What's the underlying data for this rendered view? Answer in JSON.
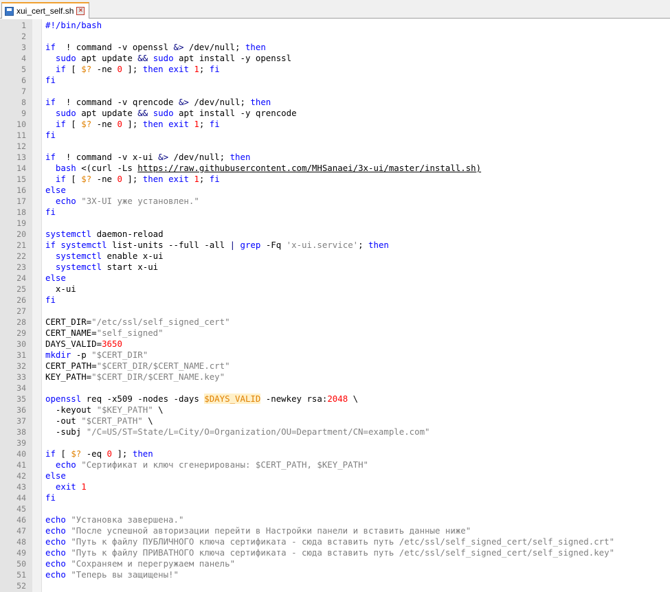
{
  "tab": {
    "filename": "xui_cert_self.sh"
  },
  "colors": {
    "keyword": "#0000ff",
    "number": "#ff0000",
    "string": "#808080",
    "variable": "#e08000",
    "tab_accent": "#f0a030",
    "gutter_bg": "#e4e4e4"
  },
  "icons": {
    "tab_file": "save-icon",
    "tab_close": "close-icon"
  },
  "lines": [
    [
      [
        "kw",
        "#!/bin/bash"
      ]
    ],
    [],
    [
      [
        "kw",
        "if"
      ],
      [
        "",
        "  "
      ],
      [
        "",
        "! command -v openssl "
      ],
      [
        "op",
        "&>"
      ],
      [
        "",
        " /dev/null; "
      ],
      [
        "kw",
        "then"
      ]
    ],
    [
      [
        "",
        "  "
      ],
      [
        "kw",
        "sudo"
      ],
      [
        "",
        " apt update "
      ],
      [
        "op",
        "&&"
      ],
      [
        "",
        " "
      ],
      [
        "kw",
        "sudo"
      ],
      [
        "",
        " apt install -y openssl"
      ]
    ],
    [
      [
        "",
        "  "
      ],
      [
        "kw",
        "if"
      ],
      [
        "",
        " [ "
      ],
      [
        "var",
        "$?"
      ],
      [
        "",
        " -ne "
      ],
      [
        "num",
        "0"
      ],
      [
        "",
        " ]; "
      ],
      [
        "kw",
        "then"
      ],
      [
        "",
        " "
      ],
      [
        "kw",
        "exit"
      ],
      [
        "",
        " "
      ],
      [
        "num",
        "1"
      ],
      [
        "",
        "; "
      ],
      [
        "kw",
        "fi"
      ]
    ],
    [
      [
        "kw",
        "fi"
      ]
    ],
    [],
    [
      [
        "kw",
        "if"
      ],
      [
        "",
        "  "
      ],
      [
        "",
        "! command -v qrencode "
      ],
      [
        "op",
        "&>"
      ],
      [
        "",
        " /dev/null; "
      ],
      [
        "kw",
        "then"
      ]
    ],
    [
      [
        "",
        "  "
      ],
      [
        "kw",
        "sudo"
      ],
      [
        "",
        " apt update "
      ],
      [
        "op",
        "&&"
      ],
      [
        "",
        " "
      ],
      [
        "kw",
        "sudo"
      ],
      [
        "",
        " apt install -y qrencode"
      ]
    ],
    [
      [
        "",
        "  "
      ],
      [
        "kw",
        "if"
      ],
      [
        "",
        " [ "
      ],
      [
        "var",
        "$?"
      ],
      [
        "",
        " -ne "
      ],
      [
        "num",
        "0"
      ],
      [
        "",
        " ]; "
      ],
      [
        "kw",
        "then"
      ],
      [
        "",
        " "
      ],
      [
        "kw",
        "exit"
      ],
      [
        "",
        " "
      ],
      [
        "num",
        "1"
      ],
      [
        "",
        "; "
      ],
      [
        "kw",
        "fi"
      ]
    ],
    [
      [
        "kw",
        "fi"
      ]
    ],
    [],
    [
      [
        "kw",
        "if"
      ],
      [
        "",
        "  "
      ],
      [
        "",
        "! command -v x-ui "
      ],
      [
        "op",
        "&>"
      ],
      [
        "",
        " /dev/null; "
      ],
      [
        "kw",
        "then"
      ]
    ],
    [
      [
        "",
        "  "
      ],
      [
        "kw",
        "bash"
      ],
      [
        "",
        " <(curl -Ls "
      ],
      [
        "url",
        "https://raw.githubusercontent.com/MHSanaei/3x-ui/master/install.sh)"
      ]
    ],
    [
      [
        "",
        "  "
      ],
      [
        "kw",
        "if"
      ],
      [
        "",
        " [ "
      ],
      [
        "var",
        "$?"
      ],
      [
        "",
        " -ne "
      ],
      [
        "num",
        "0"
      ],
      [
        "",
        " ]; "
      ],
      [
        "kw",
        "then"
      ],
      [
        "",
        " "
      ],
      [
        "kw",
        "exit"
      ],
      [
        "",
        " "
      ],
      [
        "num",
        "1"
      ],
      [
        "",
        "; "
      ],
      [
        "kw",
        "fi"
      ]
    ],
    [
      [
        "kw",
        "else"
      ]
    ],
    [
      [
        "",
        "  "
      ],
      [
        "kw",
        "echo"
      ],
      [
        "",
        " "
      ],
      [
        "str",
        "\"3X-UI уже установлен.\""
      ]
    ],
    [
      [
        "kw",
        "fi"
      ]
    ],
    [],
    [
      [
        "kw",
        "systemctl"
      ],
      [
        "",
        " daemon-reload"
      ]
    ],
    [
      [
        "kw",
        "if"
      ],
      [
        "",
        " "
      ],
      [
        "kw",
        "systemctl"
      ],
      [
        "",
        " list-units --full -all "
      ],
      [
        "op",
        "|"
      ],
      [
        "",
        " "
      ],
      [
        "kw",
        "grep"
      ],
      [
        "",
        " -Fq "
      ],
      [
        "str",
        "'x-ui.service'"
      ],
      [
        "",
        "; "
      ],
      [
        "kw",
        "then"
      ]
    ],
    [
      [
        "",
        "  "
      ],
      [
        "kw",
        "systemctl"
      ],
      [
        "",
        " enable x-ui"
      ]
    ],
    [
      [
        "",
        "  "
      ],
      [
        "kw",
        "systemctl"
      ],
      [
        "",
        " start x-ui"
      ]
    ],
    [
      [
        "kw",
        "else"
      ]
    ],
    [
      [
        "",
        "  x-ui"
      ]
    ],
    [
      [
        "kw",
        "fi"
      ]
    ],
    [],
    [
      [
        "",
        "CERT_DIR="
      ],
      [
        "str",
        "\"/etc/ssl/self_signed_cert\""
      ]
    ],
    [
      [
        "",
        "CERT_NAME="
      ],
      [
        "str",
        "\"self_signed\""
      ]
    ],
    [
      [
        "",
        "DAYS_VALID="
      ],
      [
        "num",
        "3650"
      ]
    ],
    [
      [
        "kw",
        "mkdir"
      ],
      [
        "",
        " -p "
      ],
      [
        "str",
        "\"$CERT_DIR\""
      ]
    ],
    [
      [
        "",
        "CERT_PATH="
      ],
      [
        "str",
        "\"$CERT_DIR/$CERT_NAME.crt\""
      ]
    ],
    [
      [
        "",
        "KEY_PATH="
      ],
      [
        "str",
        "\"$CERT_DIR/$CERT_NAME.key\""
      ]
    ],
    [],
    [
      [
        "kw",
        "openssl"
      ],
      [
        "",
        " req -x509 -nodes -days "
      ],
      [
        "hlvar",
        "$DAYS_VALID"
      ],
      [
        "",
        " -newkey rsa:"
      ],
      [
        "num",
        "2048"
      ],
      [
        "",
        " \\"
      ]
    ],
    [
      [
        "",
        "  -keyout "
      ],
      [
        "str",
        "\"$KEY_PATH\""
      ],
      [
        "",
        " \\"
      ]
    ],
    [
      [
        "",
        "  -out "
      ],
      [
        "str",
        "\"$CERT_PATH\""
      ],
      [
        "",
        " \\"
      ]
    ],
    [
      [
        "",
        "  -subj "
      ],
      [
        "str",
        "\"/C=US/ST=State/L=City/O=Organization/OU=Department/CN=example.com\""
      ]
    ],
    [],
    [
      [
        "kw",
        "if"
      ],
      [
        "",
        " [ "
      ],
      [
        "var",
        "$?"
      ],
      [
        "",
        " -eq "
      ],
      [
        "num",
        "0"
      ],
      [
        "",
        " ]; "
      ],
      [
        "kw",
        "then"
      ]
    ],
    [
      [
        "",
        "  "
      ],
      [
        "kw",
        "echo"
      ],
      [
        "",
        " "
      ],
      [
        "str",
        "\"Сертификат и ключ сгенерированы: $CERT_PATH, $KEY_PATH\""
      ]
    ],
    [
      [
        "kw",
        "else"
      ]
    ],
    [
      [
        "",
        "  "
      ],
      [
        "kw",
        "exit"
      ],
      [
        "",
        " "
      ],
      [
        "num",
        "1"
      ]
    ],
    [
      [
        "kw",
        "fi"
      ]
    ],
    [],
    [
      [
        "kw",
        "echo"
      ],
      [
        "",
        " "
      ],
      [
        "str",
        "\"Установка завершена.\""
      ]
    ],
    [
      [
        "kw",
        "echo"
      ],
      [
        "",
        " "
      ],
      [
        "str",
        "\"После успешной авторизации перейти в Настройки панели и вставить данные ниже\""
      ]
    ],
    [
      [
        "kw",
        "echo"
      ],
      [
        "",
        " "
      ],
      [
        "str",
        "\"Путь к файлу ПУБЛИЧНОГО ключа сертификата - сюда вставить путь /etc/ssl/self_signed_cert/self_signed.crt\""
      ]
    ],
    [
      [
        "kw",
        "echo"
      ],
      [
        "",
        " "
      ],
      [
        "str",
        "\"Путь к файлу ПРИВАТНОГО ключа сертификата - сюда вставить путь /etc/ssl/self_signed_cert/self_signed.key\""
      ]
    ],
    [
      [
        "kw",
        "echo"
      ],
      [
        "",
        " "
      ],
      [
        "str",
        "\"Сохраняем и перегружаем панель\""
      ]
    ],
    [
      [
        "kw",
        "echo"
      ],
      [
        "",
        " "
      ],
      [
        "str",
        "\"Теперь вы защищены!\""
      ]
    ],
    []
  ]
}
